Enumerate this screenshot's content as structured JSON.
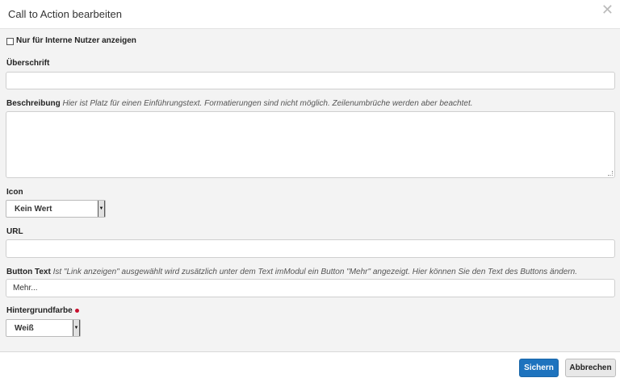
{
  "dialog": {
    "title": "Call to Action bearbeiten",
    "close_glyph": "✕"
  },
  "form": {
    "internal_only": {
      "label": "Nur für Interne Nutzer anzeigen",
      "checked": false
    },
    "heading": {
      "label": "Überschrift",
      "value": ""
    },
    "description": {
      "label": "Beschreibung",
      "hint": "Hier ist Platz für einen Einführungstext. Formatierungen sind nicht möglich. Zeilenumbrüche werden aber beachtet.",
      "value": ""
    },
    "icon": {
      "label": "Icon",
      "selected": "Kein Wert"
    },
    "url": {
      "label": "URL",
      "value": ""
    },
    "button_text": {
      "label": "Button Text",
      "hint": "Ist \"Link anzeigen\" ausgewählt wird zusätzlich unter dem Text imModul ein Button \"Mehr\" angezeigt. Hier können Sie den Text des Buttons ändern.",
      "value": "Mehr..."
    },
    "background": {
      "label": "Hintergrundfarbe",
      "selected": "Weiß",
      "required_color": "#c8102e"
    }
  },
  "footer": {
    "save_label": "Sichern",
    "cancel_label": "Abbrechen"
  },
  "colors": {
    "primary": "#1e73be",
    "background": "#f3f3f3"
  }
}
